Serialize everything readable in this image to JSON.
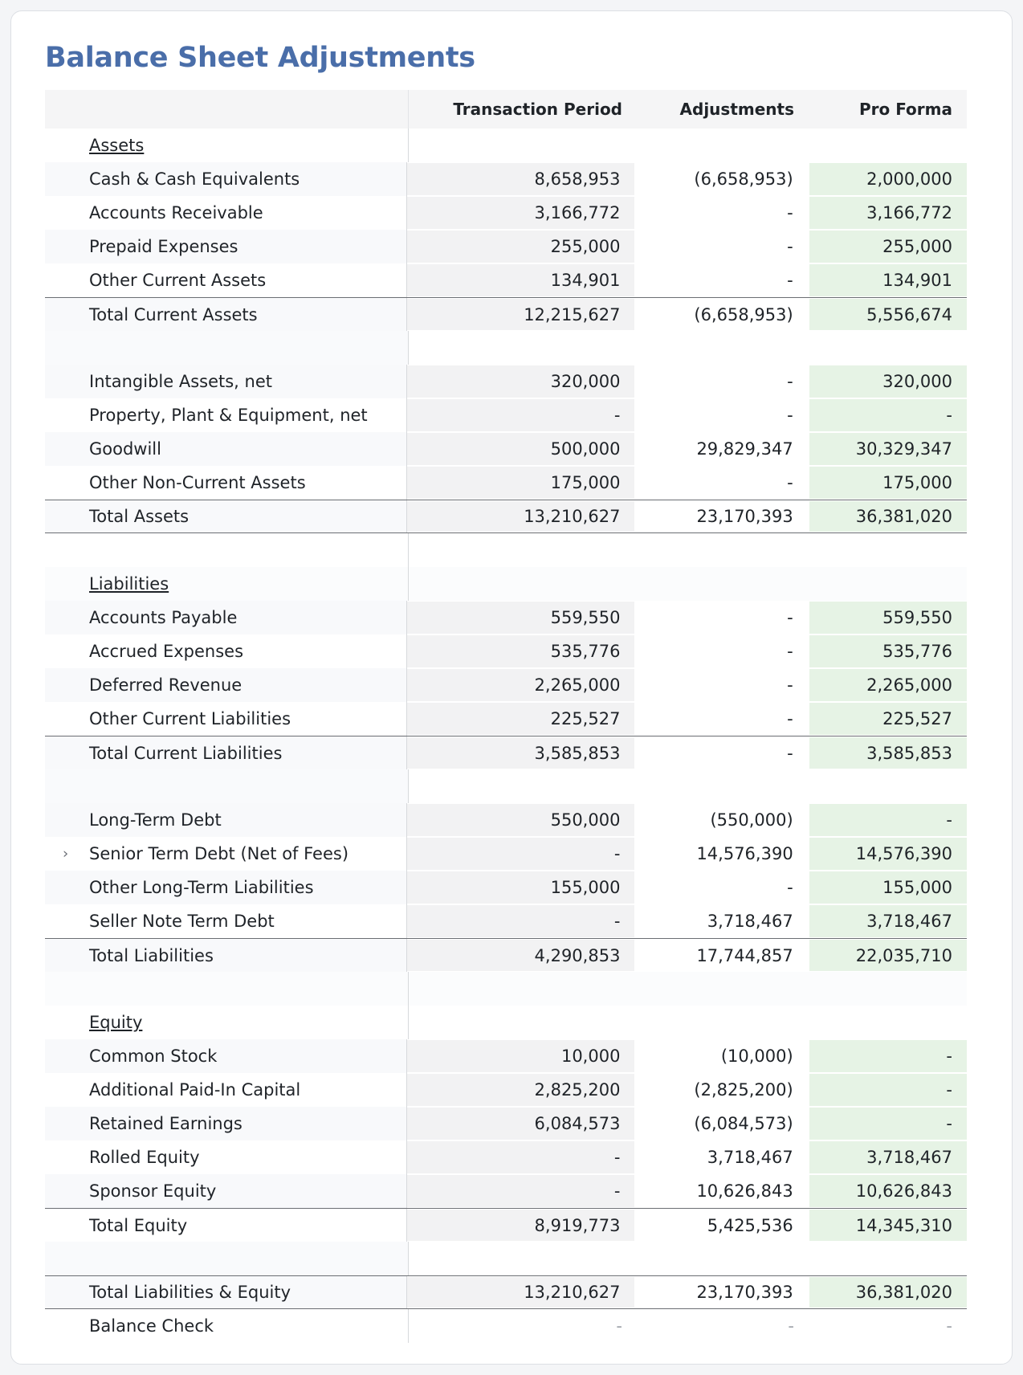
{
  "title": "Balance Sheet Adjustments",
  "header": {
    "label": "",
    "transaction_period": "Transaction Period",
    "adjustments": "Adjustments",
    "pro_forma": "Pro Forma"
  },
  "sections": {
    "assets": "Assets",
    "liabilities": "Liabilities",
    "equity": "Equity"
  },
  "rows": {
    "cash": {
      "label": "Cash & Cash Equivalents",
      "tp": "8,658,953",
      "adj": "(6,658,953)",
      "pf": "2,000,000"
    },
    "ar": {
      "label": "Accounts Receivable",
      "tp": "3,166,772",
      "adj": "-",
      "pf": "3,166,772"
    },
    "prepaid": {
      "label": "Prepaid Expenses",
      "tp": "255,000",
      "adj": "-",
      "pf": "255,000"
    },
    "oca": {
      "label": "Other Current Assets",
      "tp": "134,901",
      "adj": "-",
      "pf": "134,901"
    },
    "tca": {
      "label": "Total Current Assets",
      "tp": "12,215,627",
      "adj": "(6,658,953)",
      "pf": "5,556,674"
    },
    "intangible": {
      "label": "Intangible Assets, net",
      "tp": "320,000",
      "adj": "-",
      "pf": "320,000"
    },
    "ppe": {
      "label": "Property, Plant & Equipment, net",
      "tp": "-",
      "adj": "-",
      "pf": "-"
    },
    "goodwill": {
      "label": "Goodwill",
      "tp": "500,000",
      "adj": "29,829,347",
      "pf": "30,329,347"
    },
    "onca": {
      "label": "Other Non-Current Assets",
      "tp": "175,000",
      "adj": "-",
      "pf": "175,000"
    },
    "ta": {
      "label": "Total Assets",
      "tp": "13,210,627",
      "adj": "23,170,393",
      "pf": "36,381,020"
    },
    "ap": {
      "label": "Accounts Payable",
      "tp": "559,550",
      "adj": "-",
      "pf": "559,550"
    },
    "accrued": {
      "label": "Accrued Expenses",
      "tp": "535,776",
      "adj": "-",
      "pf": "535,776"
    },
    "deferred": {
      "label": "Deferred Revenue",
      "tp": "2,265,000",
      "adj": "-",
      "pf": "2,265,000"
    },
    "ocl": {
      "label": "Other Current Liabilities",
      "tp": "225,527",
      "adj": "-",
      "pf": "225,527"
    },
    "tcl": {
      "label": "Total Current Liabilities",
      "tp": "3,585,853",
      "adj": "-",
      "pf": "3,585,853"
    },
    "ltd": {
      "label": "Long-Term Debt",
      "tp": "550,000",
      "adj": "(550,000)",
      "pf": "-"
    },
    "senior": {
      "label": "Senior Term Debt (Net of Fees)",
      "tp": "-",
      "adj": "14,576,390",
      "pf": "14,576,390"
    },
    "oltl": {
      "label": "Other Long-Term Liabilities",
      "tp": "155,000",
      "adj": "-",
      "pf": "155,000"
    },
    "seller": {
      "label": "Seller Note Term Debt",
      "tp": "-",
      "adj": "3,718,467",
      "pf": "3,718,467"
    },
    "tl": {
      "label": "Total Liabilities",
      "tp": "4,290,853",
      "adj": "17,744,857",
      "pf": "22,035,710"
    },
    "common": {
      "label": "Common Stock",
      "tp": "10,000",
      "adj": "(10,000)",
      "pf": "-"
    },
    "apic": {
      "label": "Additional Paid-In Capital",
      "tp": "2,825,200",
      "adj": "(2,825,200)",
      "pf": "-"
    },
    "retained": {
      "label": "Retained Earnings",
      "tp": "6,084,573",
      "adj": "(6,084,573)",
      "pf": "-"
    },
    "rolled": {
      "label": "Rolled Equity",
      "tp": "-",
      "adj": "3,718,467",
      "pf": "3,718,467"
    },
    "sponsor": {
      "label": "Sponsor Equity",
      "tp": "-",
      "adj": "10,626,843",
      "pf": "10,626,843"
    },
    "te": {
      "label": "Total Equity",
      "tp": "8,919,773",
      "adj": "5,425,536",
      "pf": "14,345,310"
    },
    "tle": {
      "label": "Total Liabilities & Equity",
      "tp": "13,210,627",
      "adj": "23,170,393",
      "pf": "36,381,020"
    },
    "check": {
      "label": "Balance Check",
      "tp": "-",
      "adj": "-",
      "pf": "-"
    }
  },
  "icons": {
    "expand": "chevron-right-icon"
  },
  "colors": {
    "title": "#4a6ea9",
    "pro_forma_bg": "#e6f3e5",
    "transaction_bg": "#f2f2f3"
  }
}
